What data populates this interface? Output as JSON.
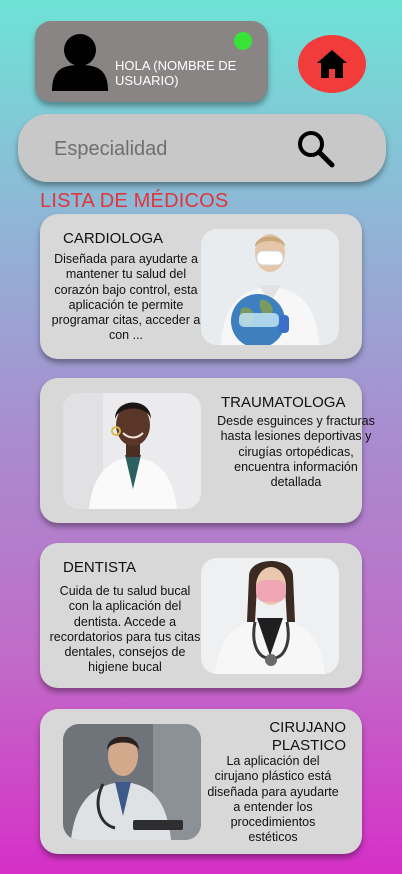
{
  "header": {
    "greeting": "HOLA (NOMBRE DE USUARIO)",
    "status_color": "#37e337",
    "avatar_icon": "user-avatar-icon",
    "home_icon": "home-icon",
    "home_button_color": "#f23c3c"
  },
  "search": {
    "placeholder": "Especialidad",
    "value": "",
    "icon": "search-icon"
  },
  "list": {
    "title": "LISTA DE MÉDICOS",
    "title_color": "#e0353a",
    "doctors": [
      {
        "name": "CARDIOLOGA",
        "description": "Diseñada para ayudarte a mantener tu salud del corazón bajo control, esta aplicación te permite programar citas, acceder a con ..."
      },
      {
        "name": "TRAUMATOLOGA",
        "description": "Desde esguinces y fracturas hasta lesiones deportivas y cirugías ortopédicas, encuentra información detallada"
      },
      {
        "name": "DENTISTA",
        "description": "Cuida de tu salud bucal con la aplicación del dentista. Accede a recordatorios para tus citas dentales, consejos de higiene bucal"
      },
      {
        "name": "CIRUJANO PLASTICO",
        "description": "La aplicación del cirujano plástico está diseñada para ayudarte a entender los procedimientos estéticos"
      }
    ]
  }
}
